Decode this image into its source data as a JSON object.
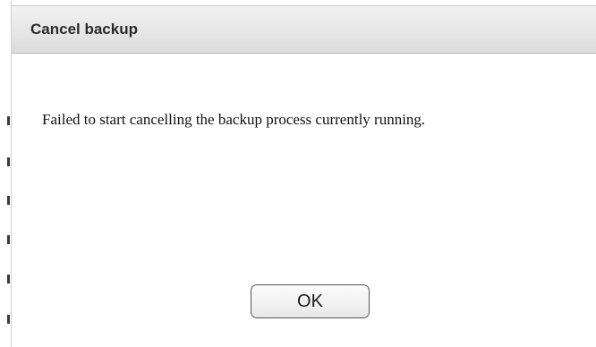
{
  "dialog": {
    "title": "Cancel backup",
    "message": "Failed to start cancelling the backup process currently running.",
    "ok_label": "OK"
  },
  "colors": {
    "titlebar_top": "#f2f2f2",
    "titlebar_bottom": "#dcdcdc",
    "button_border": "#555555",
    "text": "#111111"
  }
}
